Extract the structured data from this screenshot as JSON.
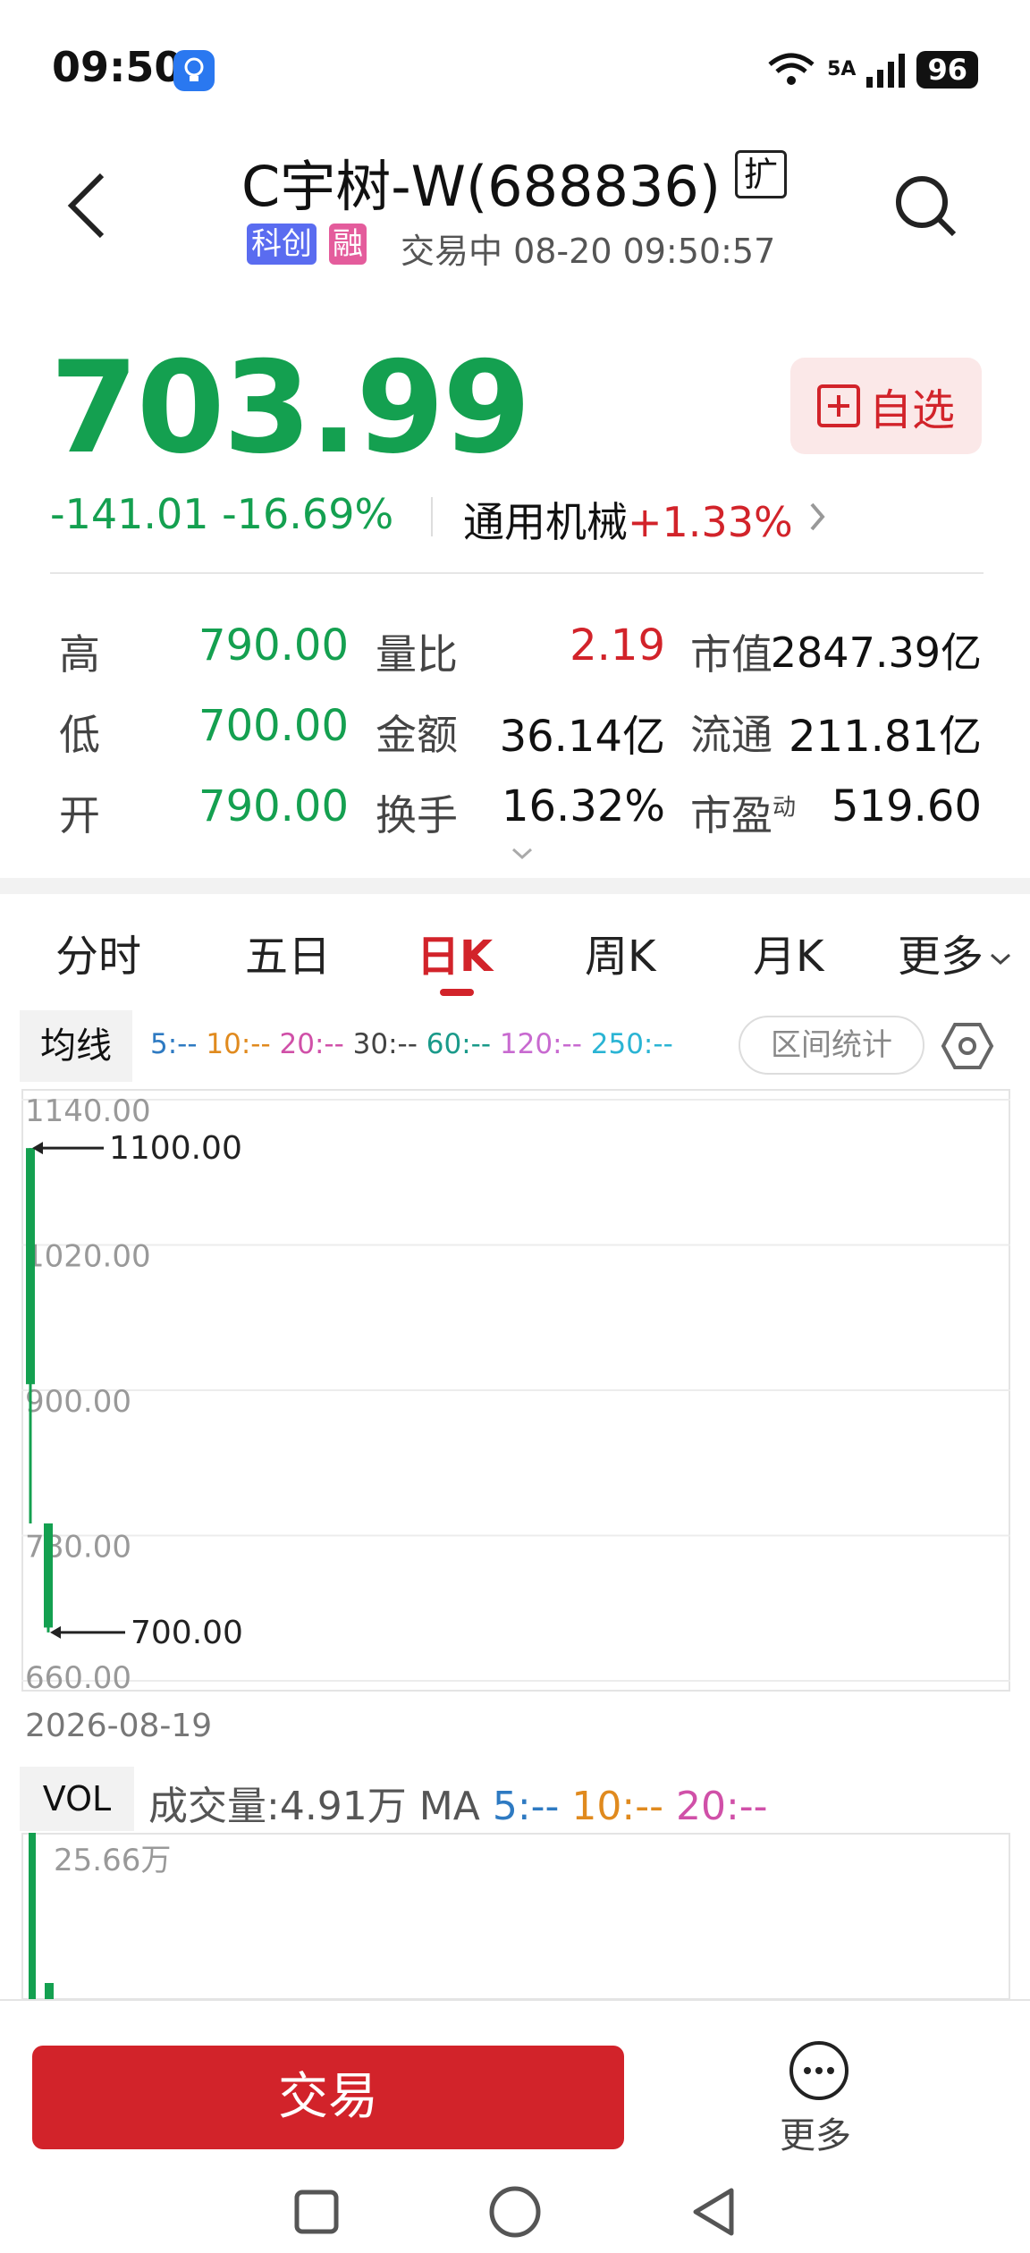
{
  "status_bar": {
    "time": "09:50",
    "network": "5A",
    "battery": "96"
  },
  "header": {
    "title": "C宇树-W(688836)",
    "ext_badge": "扩",
    "tag_kc": "科创",
    "tag_rong": "融",
    "trade_status": "交易中  08-20  09:50:57"
  },
  "quote": {
    "price": "703.99",
    "change": "-141.01  -16.69%",
    "sector_name": "通用机械",
    "sector_change": "+1.33%",
    "watch_label": "自选"
  },
  "stats": {
    "high_label": "高",
    "high": "790.00",
    "low_label": "低",
    "low": "700.00",
    "open_label": "开",
    "open": "790.00",
    "vol_ratio_label": "量比",
    "vol_ratio": "2.19",
    "amount_label": "金额",
    "amount": "36.14亿",
    "turnover_label": "换手",
    "turnover": "16.32%",
    "mktcap_label": "市值",
    "mktcap": "2847.39亿",
    "float_label": "流通",
    "float": "211.81亿",
    "pe_label": "市盈",
    "pe_sup": "动",
    "pe": "519.60"
  },
  "tabs": [
    "分时",
    "五日",
    "日K",
    "周K",
    "月K",
    "更多"
  ],
  "ma": {
    "label": "均线",
    "items": [
      {
        "text": "5:--",
        "color": "#2e7ac2"
      },
      {
        "text": "10:--",
        "color": "#e08a1e"
      },
      {
        "text": "20:--",
        "color": "#d050a8"
      },
      {
        "text": "30:--",
        "color": "#444444"
      },
      {
        "text": "60:--",
        "color": "#1a9a8a"
      },
      {
        "text": "120:--",
        "color": "#c86ad0"
      },
      {
        "text": "250:--",
        "color": "#2ab4d4"
      }
    ],
    "range_stats": "区间统计"
  },
  "chart_data": {
    "type": "candlestick",
    "y_ticks": [
      "1140.00",
      "1020.00",
      "900.00",
      "780.00",
      "660.00"
    ],
    "ylim": [
      660,
      1140
    ],
    "candles": [
      {
        "date": "2026-08-19",
        "open": 1100,
        "close": 905,
        "high": 1100,
        "low": 790
      },
      {
        "date": "2026-08-20",
        "open": 790,
        "close": 703.99,
        "high": 790,
        "low": 700
      }
    ],
    "annotations": [
      {
        "text": "1100.00",
        "value": 1100
      },
      {
        "text": "700.00",
        "value": 700
      }
    ],
    "date_label": "2026-08-19"
  },
  "volume": {
    "label": "VOL",
    "info_prefix": "成交量:4.91万 MA ",
    "ma5": "5:--",
    "ma10": "10:--",
    "ma20": "20:--",
    "max_label": "25.66万"
  },
  "bottom": {
    "trade": "交易",
    "more": "更多"
  },
  "colors": {
    "down": "#14a050",
    "up": "#d2232a"
  }
}
